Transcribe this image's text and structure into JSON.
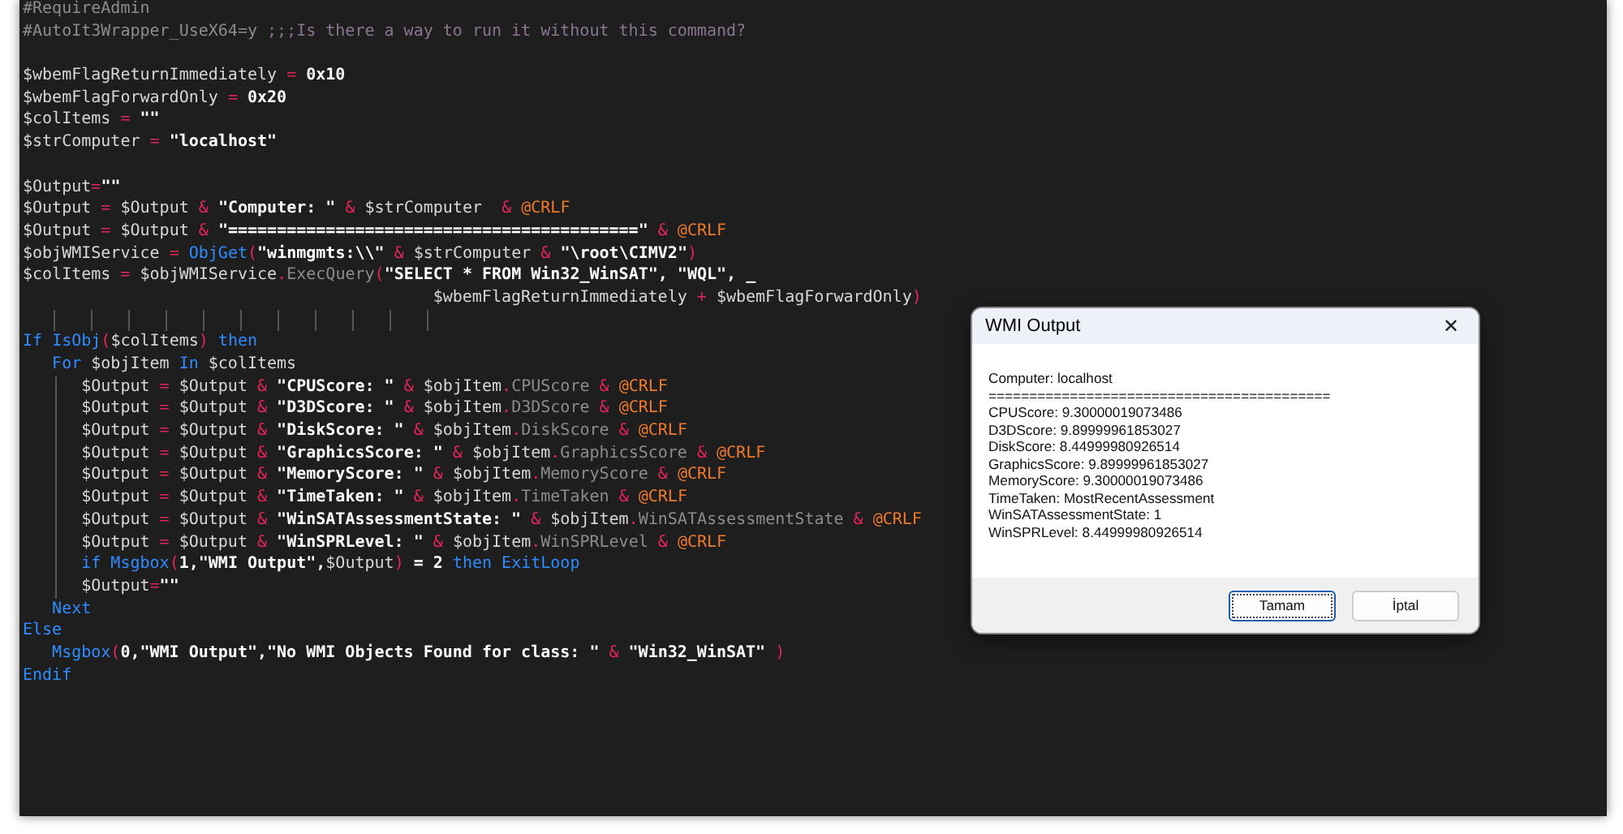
{
  "editor": {
    "lines": [
      {
        "kind": "code",
        "tokens": [
          {
            "kind": "directive",
            "text": "#RequireAdmin"
          }
        ]
      },
      {
        "kind": "code",
        "tokens": [
          {
            "kind": "directive",
            "text": "#AutoIt3Wrapper_UseX64=y"
          },
          {
            "kind": "comment",
            "text": " ;;;Is there a way to run it without this command?"
          }
        ]
      },
      {
        "kind": "blank"
      },
      {
        "kind": "code",
        "tokens": [
          {
            "kind": "var",
            "text": "$wbemFlagReturnImmediately "
          },
          {
            "kind": "op",
            "text": "="
          },
          {
            "kind": "num",
            "text": " 0x10"
          }
        ]
      },
      {
        "kind": "code",
        "tokens": [
          {
            "kind": "var",
            "text": "$wbemFlagForwardOnly "
          },
          {
            "kind": "op",
            "text": "="
          },
          {
            "kind": "num",
            "text": " 0x20"
          }
        ]
      },
      {
        "kind": "code",
        "tokens": [
          {
            "kind": "var",
            "text": "$colItems "
          },
          {
            "kind": "op",
            "text": "="
          },
          {
            "kind": "str",
            "text": " \"\""
          }
        ]
      },
      {
        "kind": "code",
        "tokens": [
          {
            "kind": "var",
            "text": "$strComputer "
          },
          {
            "kind": "op",
            "text": "="
          },
          {
            "kind": "str",
            "text": " \"localhost\""
          }
        ]
      },
      {
        "kind": "blank"
      },
      {
        "kind": "code",
        "tokens": [
          {
            "kind": "var",
            "text": "$Output"
          },
          {
            "kind": "op",
            "text": "="
          },
          {
            "kind": "str",
            "text": "\"\""
          }
        ]
      },
      {
        "kind": "code",
        "tokens": [
          {
            "kind": "var",
            "text": "$Output "
          },
          {
            "kind": "op",
            "text": "="
          },
          {
            "kind": "var",
            "text": " $Output "
          },
          {
            "kind": "op",
            "text": "&"
          },
          {
            "kind": "str",
            "text": " \"Computer: \" "
          },
          {
            "kind": "op",
            "text": "&"
          },
          {
            "kind": "var",
            "text": " $strComputer  "
          },
          {
            "kind": "op",
            "text": "&"
          },
          {
            "kind": "macro",
            "text": " @CRLF"
          }
        ]
      },
      {
        "kind": "code",
        "tokens": [
          {
            "kind": "var",
            "text": "$Output "
          },
          {
            "kind": "op",
            "text": "="
          },
          {
            "kind": "var",
            "text": " $Output "
          },
          {
            "kind": "op",
            "text": "&"
          },
          {
            "kind": "str",
            "text": " \"==========================================\" "
          },
          {
            "kind": "op",
            "text": "&"
          },
          {
            "kind": "macro",
            "text": " @CRLF"
          }
        ]
      },
      {
        "kind": "code",
        "tokens": [
          {
            "kind": "var",
            "text": "$objWMIService "
          },
          {
            "kind": "op",
            "text": "="
          },
          {
            "kind": "func",
            "text": " ObjGet"
          },
          {
            "kind": "op",
            "text": "("
          },
          {
            "kind": "str",
            "text": "\"winmgmts:\\\\\" "
          },
          {
            "kind": "op",
            "text": "&"
          },
          {
            "kind": "var",
            "text": " $strComputer "
          },
          {
            "kind": "op",
            "text": "&"
          },
          {
            "kind": "str",
            "text": " \"\\root\\CIMV2\""
          },
          {
            "kind": "op",
            "text": ")"
          }
        ]
      },
      {
        "kind": "code",
        "tokens": [
          {
            "kind": "var",
            "text": "$colItems "
          },
          {
            "kind": "op",
            "text": "="
          },
          {
            "kind": "var",
            "text": " $objWMIService"
          },
          {
            "kind": "op",
            "text": "."
          },
          {
            "kind": "prop",
            "text": "ExecQuery"
          },
          {
            "kind": "op",
            "text": "("
          },
          {
            "kind": "str",
            "text": "\"SELECT * FROM Win32_WinSAT\", \"WQL\", _"
          }
        ]
      },
      {
        "kind": "continuation",
        "tokens": [
          {
            "kind": "var",
            "text": "$wbemFlagReturnImmediately "
          },
          {
            "kind": "op",
            "text": "+"
          },
          {
            "kind": "var",
            "text": " $wbemFlagForwardOnly"
          },
          {
            "kind": "op",
            "text": ")"
          }
        ]
      },
      {
        "kind": "guides"
      },
      {
        "kind": "code",
        "tokens": [
          {
            "kind": "keyword",
            "text": "If"
          },
          {
            "kind": "func",
            "text": " IsObj"
          },
          {
            "kind": "op",
            "text": "("
          },
          {
            "kind": "var",
            "text": "$colItems"
          },
          {
            "kind": "op",
            "text": ")"
          },
          {
            "kind": "keyword",
            "text": " then"
          }
        ],
        "children": [
          {
            "kind": "code",
            "tokens": [
              {
                "kind": "keyword",
                "text": "For"
              },
              {
                "kind": "var",
                "text": " $objItem "
              },
              {
                "kind": "keyword",
                "text": "In"
              },
              {
                "kind": "var",
                "text": " $colItems"
              }
            ],
            "children": [
              {
                "kind": "code",
                "tokens": [
                  {
                    "kind": "var",
                    "text": "$Output "
                  },
                  {
                    "kind": "op",
                    "text": "="
                  },
                  {
                    "kind": "var",
                    "text": " $Output "
                  },
                  {
                    "kind": "op",
                    "text": "&"
                  },
                  {
                    "kind": "str",
                    "text": " \"CPUScore: \" "
                  },
                  {
                    "kind": "op",
                    "text": "&"
                  },
                  {
                    "kind": "var",
                    "text": " $objItem"
                  },
                  {
                    "kind": "op",
                    "text": "."
                  },
                  {
                    "kind": "prop",
                    "text": "CPUScore "
                  },
                  {
                    "kind": "op",
                    "text": "&"
                  },
                  {
                    "kind": "macro",
                    "text": " @CRLF"
                  }
                ]
              },
              {
                "kind": "code",
                "tokens": [
                  {
                    "kind": "var",
                    "text": "$Output "
                  },
                  {
                    "kind": "op",
                    "text": "="
                  },
                  {
                    "kind": "var",
                    "text": " $Output "
                  },
                  {
                    "kind": "op",
                    "text": "&"
                  },
                  {
                    "kind": "str",
                    "text": " \"D3DScore: \" "
                  },
                  {
                    "kind": "op",
                    "text": "&"
                  },
                  {
                    "kind": "var",
                    "text": " $objItem"
                  },
                  {
                    "kind": "op",
                    "text": "."
                  },
                  {
                    "kind": "prop",
                    "text": "D3DScore "
                  },
                  {
                    "kind": "op",
                    "text": "&"
                  },
                  {
                    "kind": "macro",
                    "text": " @CRLF"
                  }
                ]
              },
              {
                "kind": "code",
                "tokens": [
                  {
                    "kind": "var",
                    "text": "$Output "
                  },
                  {
                    "kind": "op",
                    "text": "="
                  },
                  {
                    "kind": "var",
                    "text": " $Output "
                  },
                  {
                    "kind": "op",
                    "text": "&"
                  },
                  {
                    "kind": "str",
                    "text": " \"DiskScore: \" "
                  },
                  {
                    "kind": "op",
                    "text": "&"
                  },
                  {
                    "kind": "var",
                    "text": " $objItem"
                  },
                  {
                    "kind": "op",
                    "text": "."
                  },
                  {
                    "kind": "prop",
                    "text": "DiskScore "
                  },
                  {
                    "kind": "op",
                    "text": "&"
                  },
                  {
                    "kind": "macro",
                    "text": " @CRLF"
                  }
                ]
              },
              {
                "kind": "code",
                "tokens": [
                  {
                    "kind": "var",
                    "text": "$Output "
                  },
                  {
                    "kind": "op",
                    "text": "="
                  },
                  {
                    "kind": "var",
                    "text": " $Output "
                  },
                  {
                    "kind": "op",
                    "text": "&"
                  },
                  {
                    "kind": "str",
                    "text": " \"GraphicsScore: \" "
                  },
                  {
                    "kind": "op",
                    "text": "&"
                  },
                  {
                    "kind": "var",
                    "text": " $objItem"
                  },
                  {
                    "kind": "op",
                    "text": "."
                  },
                  {
                    "kind": "prop",
                    "text": "GraphicsScore "
                  },
                  {
                    "kind": "op",
                    "text": "&"
                  },
                  {
                    "kind": "macro",
                    "text": " @CRLF"
                  }
                ]
              },
              {
                "kind": "code",
                "tokens": [
                  {
                    "kind": "var",
                    "text": "$Output "
                  },
                  {
                    "kind": "op",
                    "text": "="
                  },
                  {
                    "kind": "var",
                    "text": " $Output "
                  },
                  {
                    "kind": "op",
                    "text": "&"
                  },
                  {
                    "kind": "str",
                    "text": " \"MemoryScore: \" "
                  },
                  {
                    "kind": "op",
                    "text": "&"
                  },
                  {
                    "kind": "var",
                    "text": " $objItem"
                  },
                  {
                    "kind": "op",
                    "text": "."
                  },
                  {
                    "kind": "prop",
                    "text": "MemoryScore "
                  },
                  {
                    "kind": "op",
                    "text": "&"
                  },
                  {
                    "kind": "macro",
                    "text": " @CRLF"
                  }
                ]
              },
              {
                "kind": "code",
                "tokens": [
                  {
                    "kind": "var",
                    "text": "$Output "
                  },
                  {
                    "kind": "op",
                    "text": "="
                  },
                  {
                    "kind": "var",
                    "text": " $Output "
                  },
                  {
                    "kind": "op",
                    "text": "&"
                  },
                  {
                    "kind": "str",
                    "text": " \"TimeTaken: \" "
                  },
                  {
                    "kind": "op",
                    "text": "&"
                  },
                  {
                    "kind": "var",
                    "text": " $objItem"
                  },
                  {
                    "kind": "op",
                    "text": "."
                  },
                  {
                    "kind": "prop",
                    "text": "TimeTaken "
                  },
                  {
                    "kind": "op",
                    "text": "&"
                  },
                  {
                    "kind": "macro",
                    "text": " @CRLF"
                  }
                ]
              },
              {
                "kind": "code",
                "tokens": [
                  {
                    "kind": "var",
                    "text": "$Output "
                  },
                  {
                    "kind": "op",
                    "text": "="
                  },
                  {
                    "kind": "var",
                    "text": " $Output "
                  },
                  {
                    "kind": "op",
                    "text": "&"
                  },
                  {
                    "kind": "str",
                    "text": " \"WinSATAssessmentState: \" "
                  },
                  {
                    "kind": "op",
                    "text": "&"
                  },
                  {
                    "kind": "var",
                    "text": " $objItem"
                  },
                  {
                    "kind": "op",
                    "text": "."
                  },
                  {
                    "kind": "prop",
                    "text": "WinSATAssessmentState "
                  },
                  {
                    "kind": "op",
                    "text": "&"
                  },
                  {
                    "kind": "macro",
                    "text": " @CRLF"
                  }
                ]
              },
              {
                "kind": "code",
                "tokens": [
                  {
                    "kind": "var",
                    "text": "$Output "
                  },
                  {
                    "kind": "op",
                    "text": "="
                  },
                  {
                    "kind": "var",
                    "text": " $Output "
                  },
                  {
                    "kind": "op",
                    "text": "&"
                  },
                  {
                    "kind": "str",
                    "text": " \"WinSPRLevel: \" "
                  },
                  {
                    "kind": "op",
                    "text": "&"
                  },
                  {
                    "kind": "var",
                    "text": " $objItem"
                  },
                  {
                    "kind": "op",
                    "text": "."
                  },
                  {
                    "kind": "prop",
                    "text": "WinSPRLevel "
                  },
                  {
                    "kind": "op",
                    "text": "&"
                  },
                  {
                    "kind": "macro",
                    "text": " @CRLF"
                  }
                ]
              },
              {
                "kind": "code",
                "tokens": [
                  {
                    "kind": "keyword",
                    "text": "if"
                  },
                  {
                    "kind": "func",
                    "text": " Msgbox"
                  },
                  {
                    "kind": "op",
                    "text": "("
                  },
                  {
                    "kind": "str",
                    "text": "1,\"WMI Output\","
                  },
                  {
                    "kind": "var",
                    "text": "$Output"
                  },
                  {
                    "kind": "op",
                    "text": ")"
                  },
                  {
                    "kind": "str",
                    "text": " = 2"
                  },
                  {
                    "kind": "keyword",
                    "text": " then ExitLoop"
                  }
                ]
              },
              {
                "kind": "code",
                "tokens": [
                  {
                    "kind": "var",
                    "text": "$Output"
                  },
                  {
                    "kind": "op",
                    "text": "="
                  },
                  {
                    "kind": "str",
                    "text": "\"\""
                  }
                ]
              }
            ]
          },
          {
            "kind": "code",
            "tokens": [
              {
                "kind": "keyword",
                "text": "Next"
              }
            ]
          }
        ]
      },
      {
        "kind": "code",
        "tokens": [
          {
            "kind": "keyword",
            "text": "Else"
          }
        ],
        "children": [
          {
            "kind": "code",
            "tokens": [
              {
                "kind": "func",
                "text": "Msgbox"
              },
              {
                "kind": "op",
                "text": "("
              },
              {
                "kind": "str",
                "text": "0,\"WMI Output\",\"No WMI Objects Found for class: \" "
              },
              {
                "kind": "op",
                "text": "&"
              },
              {
                "kind": "str",
                "text": " \"Win32_WinSAT\" "
              },
              {
                "kind": "op",
                "text": ")"
              }
            ]
          }
        ]
      },
      {
        "kind": "code",
        "tokens": [
          {
            "kind": "keyword",
            "text": "Endif"
          }
        ]
      }
    ]
  },
  "dialog": {
    "title": "WMI Output",
    "close": "✕",
    "message": [
      "Computer: localhost",
      "==========================================",
      "CPUScore: 9.30000019073486",
      "D3DScore: 9.89999961853027",
      "DiskScore: 8.44999980926514",
      "GraphicsScore: 9.89999961853027",
      "MemoryScore: 9.30000019073486",
      "TimeTaken: MostRecentAssessment",
      "WinSATAssessmentState: 1",
      "WinSPRLevel: 8.44999980926514"
    ],
    "buttons": [
      {
        "label": "Tamam",
        "focused": true
      },
      {
        "label": "İptal",
        "focused": false
      }
    ]
  }
}
